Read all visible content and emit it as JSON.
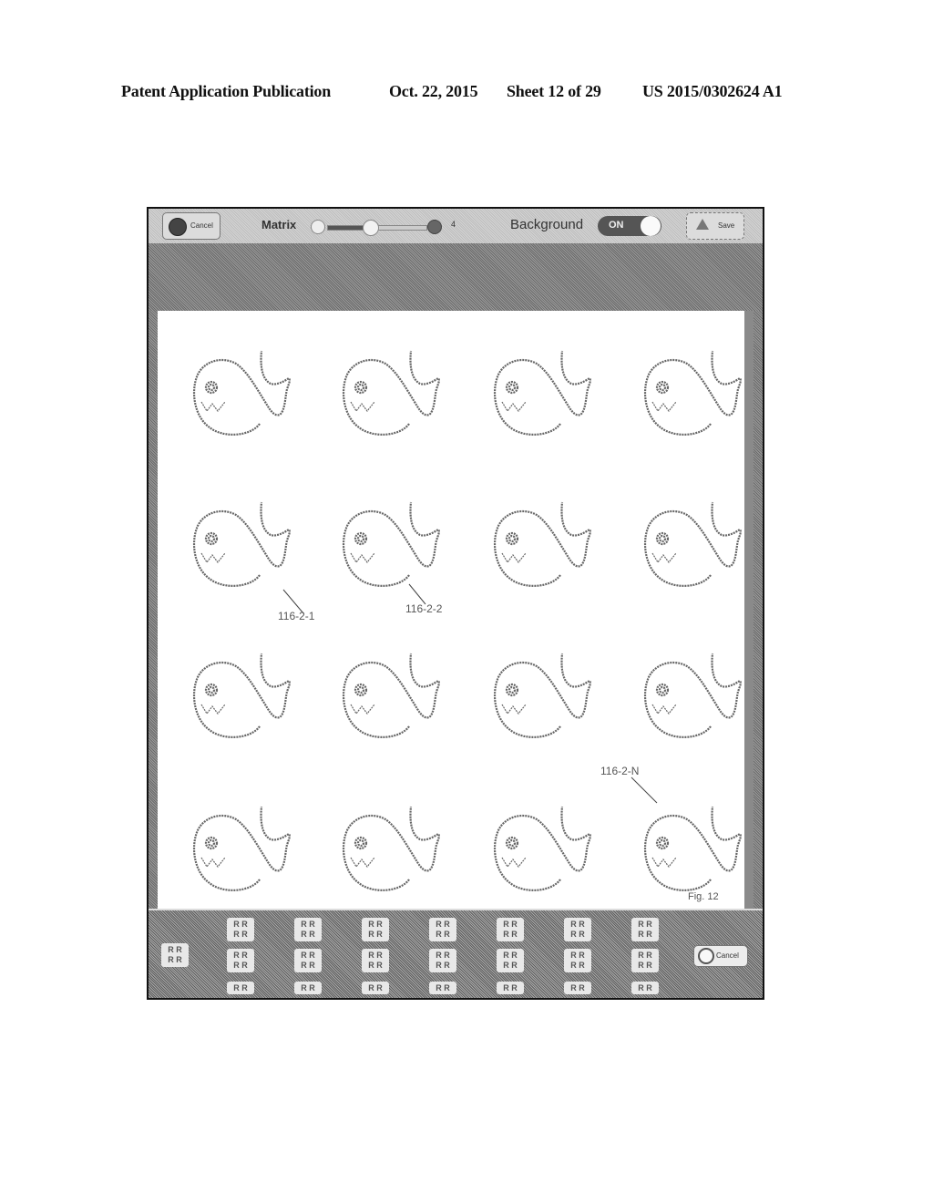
{
  "page_header": {
    "left": "Patent Application Publication",
    "date": "Oct. 22, 2015",
    "sheet": "Sheet 12 of 29",
    "number": "US 2015/0302624 A1"
  },
  "toolbar": {
    "cancel_label": "Cancel",
    "matrix_label": "Matrix",
    "matrix_value": "4",
    "matrix_slider_fraction": 0.5,
    "background_label": "Background",
    "background_toggle": "ON",
    "save_label": "Save"
  },
  "canvas": {
    "grid_rows": 4,
    "grid_cols": 4,
    "item_icon": "fish-drawing-icon",
    "callouts": [
      "116-2-1",
      "116-2-2",
      "116-2-N"
    ],
    "figure_label": "Fig. 12"
  },
  "bottom_bar": {
    "left_tile": "R R\nR R",
    "tiles_row1": [
      "R R\nR R",
      "R R\nR R",
      "R R\nR R",
      "R R\nR R",
      "R R\nR R",
      "R R\nR R",
      "R R\nR R"
    ],
    "tiles_row2": [
      "R R\nR R",
      "R R\nR R",
      "R R\nR R",
      "R R\nR R",
      "R R\nR R",
      "R R\nR R",
      "R R\nR R"
    ],
    "tiles_row3": [
      "R R",
      "R R",
      "R R",
      "R R",
      "R R",
      "R R",
      "R R"
    ],
    "cancel_label": "Cancel"
  }
}
